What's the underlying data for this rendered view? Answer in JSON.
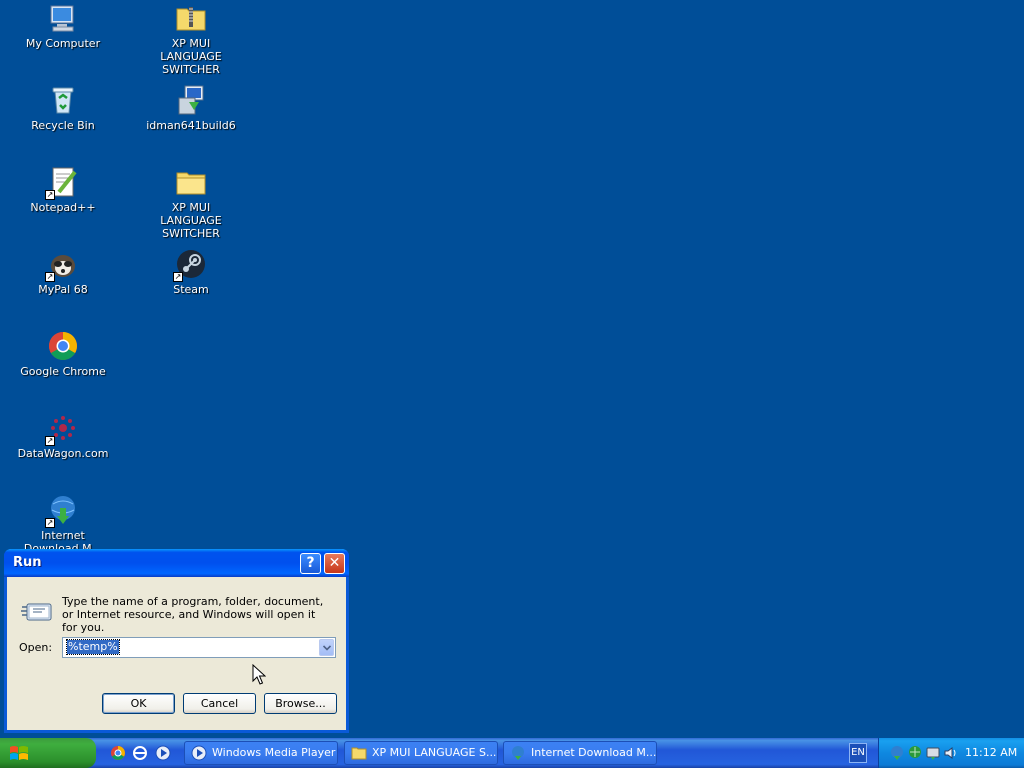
{
  "desktop": {
    "background_color": "#004e98",
    "icons": [
      {
        "label": "My Computer",
        "icon": "computer-icon"
      },
      {
        "label": "XP MUI LANGUAGE SWITCHER",
        "icon": "zip-folder-icon"
      },
      {
        "label": "Recycle Bin",
        "icon": "recycle-bin-icon"
      },
      {
        "label": "idman641build6",
        "icon": "installer-icon"
      },
      {
        "label": "Notepad++",
        "icon": "notepad-plus-icon"
      },
      {
        "label": "XP MUI LANGUAGE SWITCHER",
        "icon": "folder-icon"
      },
      {
        "label": "MyPal 68",
        "icon": "mypal-icon"
      },
      {
        "label": "Steam",
        "icon": "steam-icon"
      },
      {
        "label": "Google Chrome",
        "icon": "chrome-icon"
      },
      {
        "label": "DataWagon.com",
        "icon": "web-shortcut-icon"
      },
      {
        "label": "Internet Download M...",
        "icon": "idm-icon"
      }
    ]
  },
  "run_dialog": {
    "title": "Run",
    "description": "Type the name of a program, folder, document, or Internet resource, and Windows will open it for you.",
    "open_label": "Open:",
    "open_value": "%temp%",
    "ok_label": "OK",
    "cancel_label": "Cancel",
    "browse_label": "Browse...",
    "help_glyph": "?",
    "close_glyph": "✕"
  },
  "taskbar": {
    "tasks": [
      {
        "label": "Windows Media Player",
        "icon": "media-player-icon"
      },
      {
        "label": "XP MUI LANGUAGE S...",
        "icon": "folder-icon"
      },
      {
        "label": "Internet Download M...",
        "icon": "idm-icon"
      }
    ],
    "language": "EN",
    "clock": "11:12 AM"
  }
}
